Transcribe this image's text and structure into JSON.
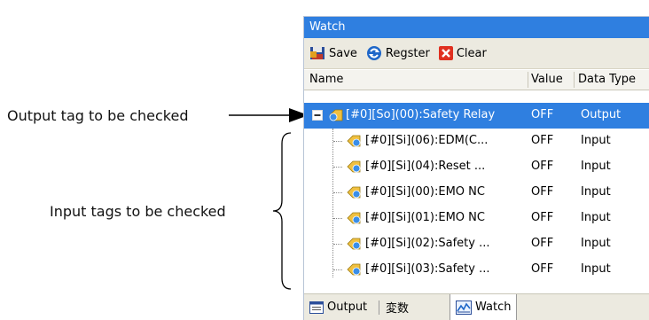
{
  "annotations": {
    "output_label": "Output tag to be checked",
    "input_label": "Input tags to be checked"
  },
  "window": {
    "title": "Watch"
  },
  "toolbar": {
    "save_label": "Save",
    "register_label": "Regster",
    "clear_label": "Clear"
  },
  "columns": {
    "name": "Name",
    "value": "Value",
    "data_type": "Data Type"
  },
  "rows": [
    {
      "name": "[#0][So](00):Safety Relay",
      "value": "OFF",
      "type": "Output"
    },
    {
      "name": "[#0][Si](06):EDM(C...",
      "value": "OFF",
      "type": "Input"
    },
    {
      "name": "[#0][Si](04):Reset ...",
      "value": "OFF",
      "type": "Input"
    },
    {
      "name": "[#0][Si](00):EMO NC",
      "value": "OFF",
      "type": "Input"
    },
    {
      "name": "[#0][Si](01):EMO NC",
      "value": "OFF",
      "type": "Input"
    },
    {
      "name": "[#0][Si](02):Safety ...",
      "value": "OFF",
      "type": "Input"
    },
    {
      "name": "[#0][Si](03):Safety ...",
      "value": "OFF",
      "type": "Input"
    }
  ],
  "tabs": {
    "output": "Output",
    "variables": "変数",
    "watch": "Watch"
  },
  "colors": {
    "accent": "#2f7fe0",
    "clear_icon": "#e03020",
    "toolbar": "#eceae0"
  }
}
